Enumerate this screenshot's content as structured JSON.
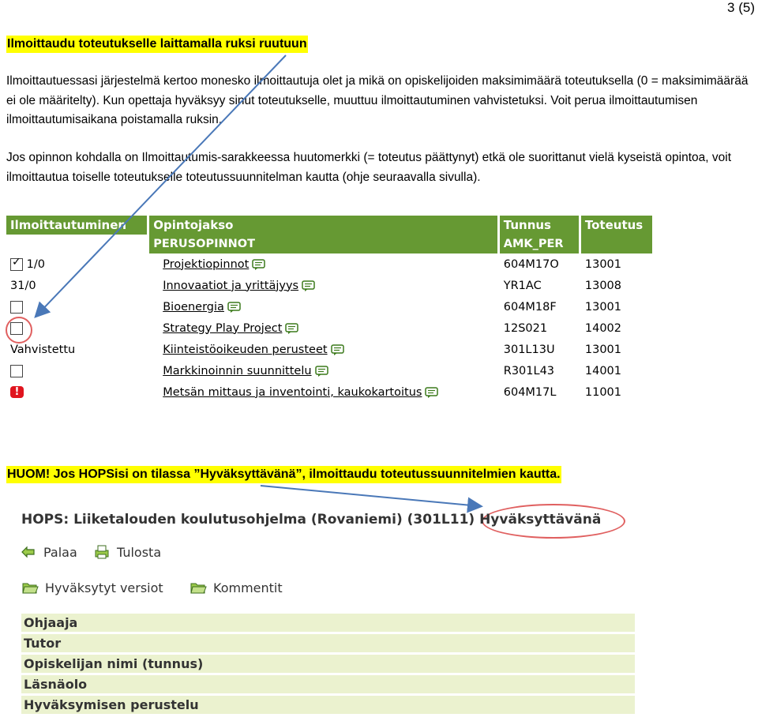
{
  "page_number": "3 (5)",
  "title": "Ilmoittaudu toteutukselle laittamalla ruksi ruutuun",
  "para1": "Ilmoittautuessasi järjestelmä kertoo monesko ilmoittautuja olet ja mikä on opiskelijoiden maksimimäärä toteutuksella (0 = maksimimäärää ei ole määritelty). Kun opettaja hyväksyy sinut toteutukselle, muuttuu ilmoittautuminen vahvistetuksi. Voit perua ilmoittautumisen ilmoittautumisaikana poistamalla ruksin.",
  "para2": "Jos opinnon kohdalla on Ilmoittautumis-sarakkeessa huutomerkki (= toteutus päättynyt) etkä ole suorittanut vielä kyseistä opintoa, voit ilmoittautua toiselle toteutukselle toteutussuunnitelman kautta (ohje seuraavalla sivulla).",
  "table": {
    "headers": [
      "Ilmoittautuminen",
      "Opintojakso",
      "Tunnus",
      "Toteutus"
    ],
    "group": {
      "name": "PERUSOPINNOT",
      "code": "AMK_PER"
    },
    "rows": [
      {
        "status_type": "checked",
        "status_text": "1/0",
        "course": "Projektiopinnot",
        "code": "604M17O",
        "impl": "13001"
      },
      {
        "status_type": "text",
        "status_text": "31/0",
        "course": "Innovaatiot ja yrittäjyys",
        "code": "YR1AC",
        "impl": "13008"
      },
      {
        "status_type": "checkbox",
        "status_text": "",
        "course": "Bioenergia",
        "code": "604M18F",
        "impl": "13001"
      },
      {
        "status_type": "checkbox",
        "status_text": "",
        "course": "Strategy Play Project",
        "code": "12S021",
        "impl": "14002"
      },
      {
        "status_type": "text",
        "status_text": "Vahvistettu",
        "course": "Kiinteistöoikeuden perusteet",
        "code": "301L13U",
        "impl": "13001"
      },
      {
        "status_type": "checkbox",
        "status_text": "",
        "course": "Markkinoinnin suunnittelu",
        "code": "R301L43",
        "impl": "14001"
      },
      {
        "status_type": "exclamation",
        "status_text": "",
        "course": "Metsän mittaus ja inventointi, kaukokartoitus",
        "code": "604M17L",
        "impl": "11001"
      }
    ]
  },
  "huom": "HUOM! Jos HOPSisi on tilassa ”Hyväksyttävänä”, ilmoittaudu toteutussuunnitelmien kautta.",
  "hops": {
    "title": "HOPS: Liiketalouden koulutusohjelma (Rovaniemi) (301L11) Hyväksyttävänä",
    "actions": {
      "back": "Palaa",
      "print": "Tulosta",
      "versions": "Hyväksytyt versiot",
      "comments": "Kommentit"
    },
    "info_rows": [
      "Ohjaaja",
      "Tutor",
      "Opiskelijan nimi (tunnus)",
      "Läsnäolo",
      "Hyväksymisen perustelu"
    ]
  },
  "colors": {
    "header_green": "#669933",
    "highlight": "#ffff00",
    "circle": "#e06060",
    "arrow": "#4a78b8",
    "info_bg": "#ebf2cf"
  }
}
